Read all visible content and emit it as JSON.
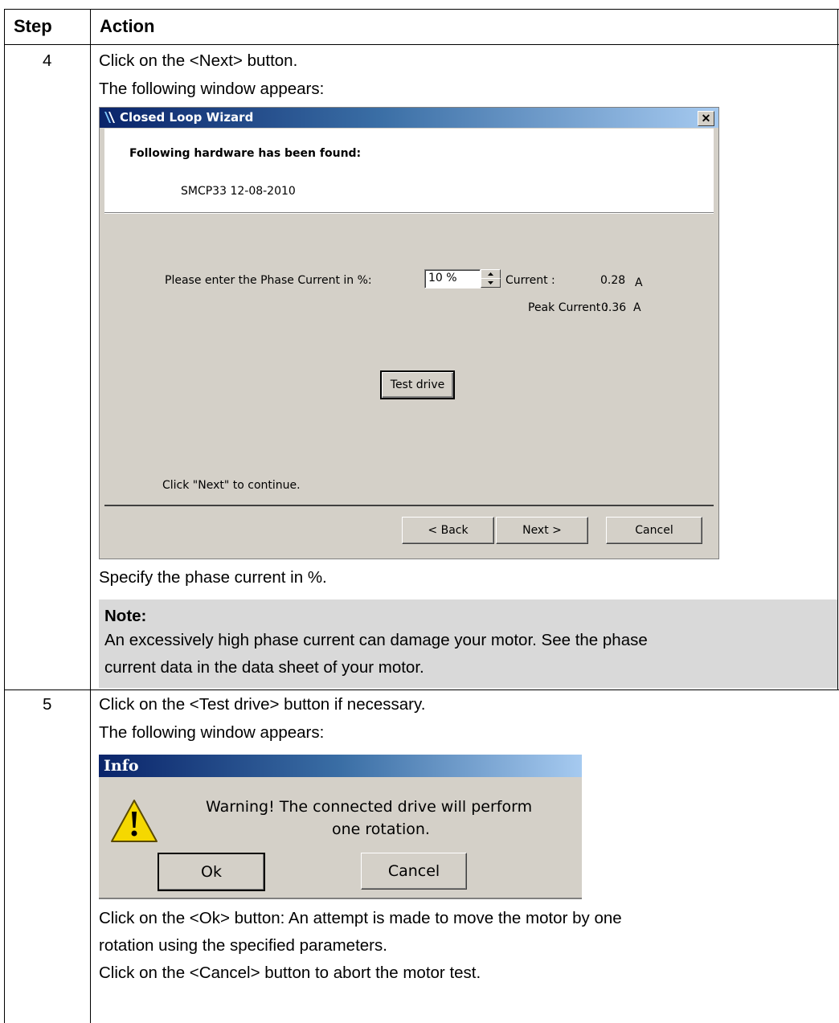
{
  "table": {
    "headers": {
      "step": "Step",
      "action": "Action"
    },
    "rows": [
      {
        "step": "4",
        "lines": [
          "Click on the <Next> button.",
          "The following window appears:",
          "Specify the phase current in %."
        ],
        "note": {
          "label": "Note:",
          "lines": [
            "An excessively high phase current can damage your motor. See the phase",
            "current data in the data sheet of your motor."
          ]
        }
      },
      {
        "step": "5",
        "lines": [
          "Click on the <Test drive> button if necessary.",
          "The following window appears:",
          "Click on the <Ok> button: An attempt is made to move the motor by one",
          "rotation using the specified parameters.",
          "Click on the <Cancel> button to abort the motor test."
        ]
      }
    ]
  },
  "wizard": {
    "title": "Closed Loop Wizard",
    "close_glyph": "✕",
    "hardware_heading": "Following hardware has been found:",
    "hardware_item": "SMCP33 12-08-2010",
    "phase_label": "Please enter the Phase Current in %:",
    "phase_value": "10 %",
    "current_label": "Current :",
    "current_value": "0.28",
    "current_unit": "A",
    "peak_label": "Peak Current :",
    "peak_value": "0.36",
    "peak_unit": "A",
    "test_drive_button": "Test drive",
    "continue_hint": "Click \"Next\" to continue.",
    "back_button": "< Back",
    "next_button": "Next >",
    "cancel_button": "Cancel",
    "title_gradient": [
      "#0a246a",
      "#a6caf0"
    ]
  },
  "info_dialog": {
    "title": "Info",
    "message_line1": "Warning! The connected drive will perform",
    "message_line2": "one rotation.",
    "ok_button": "Ok",
    "cancel_button": "Cancel",
    "icon": "warning-icon",
    "warning_color": "#f5d800"
  }
}
